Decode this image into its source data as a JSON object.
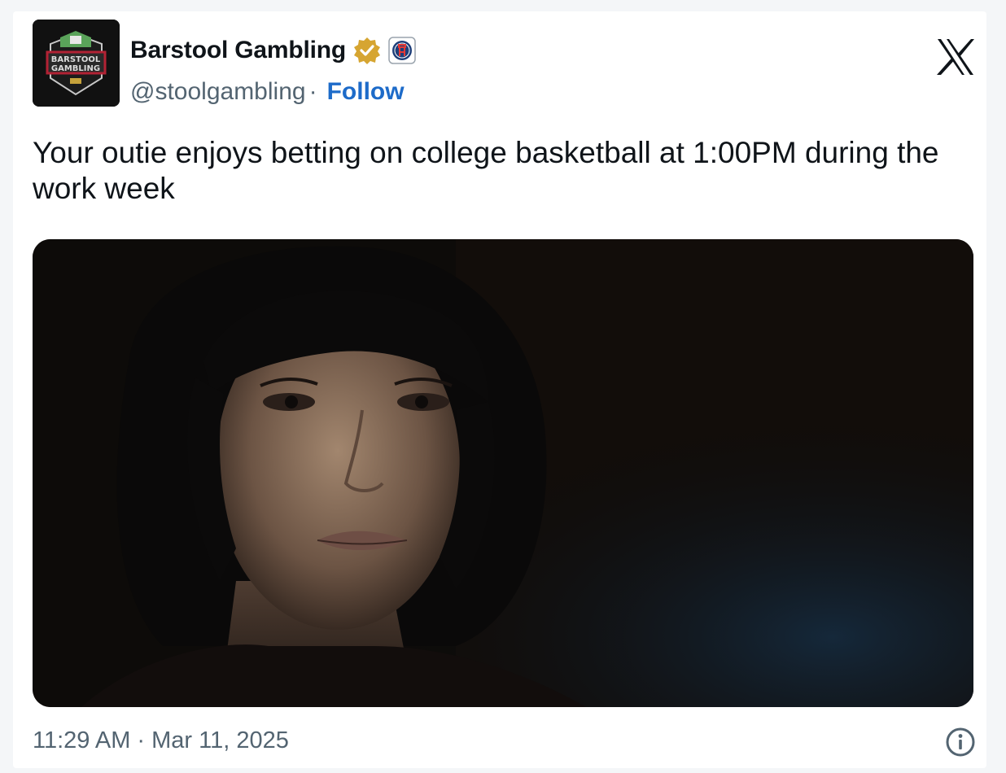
{
  "author": {
    "display_name": "Barstool Gambling",
    "handle": "@stoolgambling",
    "separator": "·",
    "follow_label": "Follow",
    "avatar_text_line1": "BARSTOOL",
    "avatar_text_line2": "GAMBLING",
    "verified_icon": "verified-badge-gold",
    "affiliate_icon": "barstool-affiliate-badge"
  },
  "brand_icon": "x-logo",
  "tweet": {
    "text": "Your outie enjoys betting on college basketball at 1:00PM during the work week",
    "media_description_icon": "photo"
  },
  "footer": {
    "timestamp": "11:29 AM · Mar 11, 2025",
    "info_icon": "info-icon"
  },
  "colors": {
    "text_primary": "#0f1419",
    "text_secondary": "#536471",
    "link": "#1d6bc9",
    "verified_gold": "#d6a531"
  }
}
